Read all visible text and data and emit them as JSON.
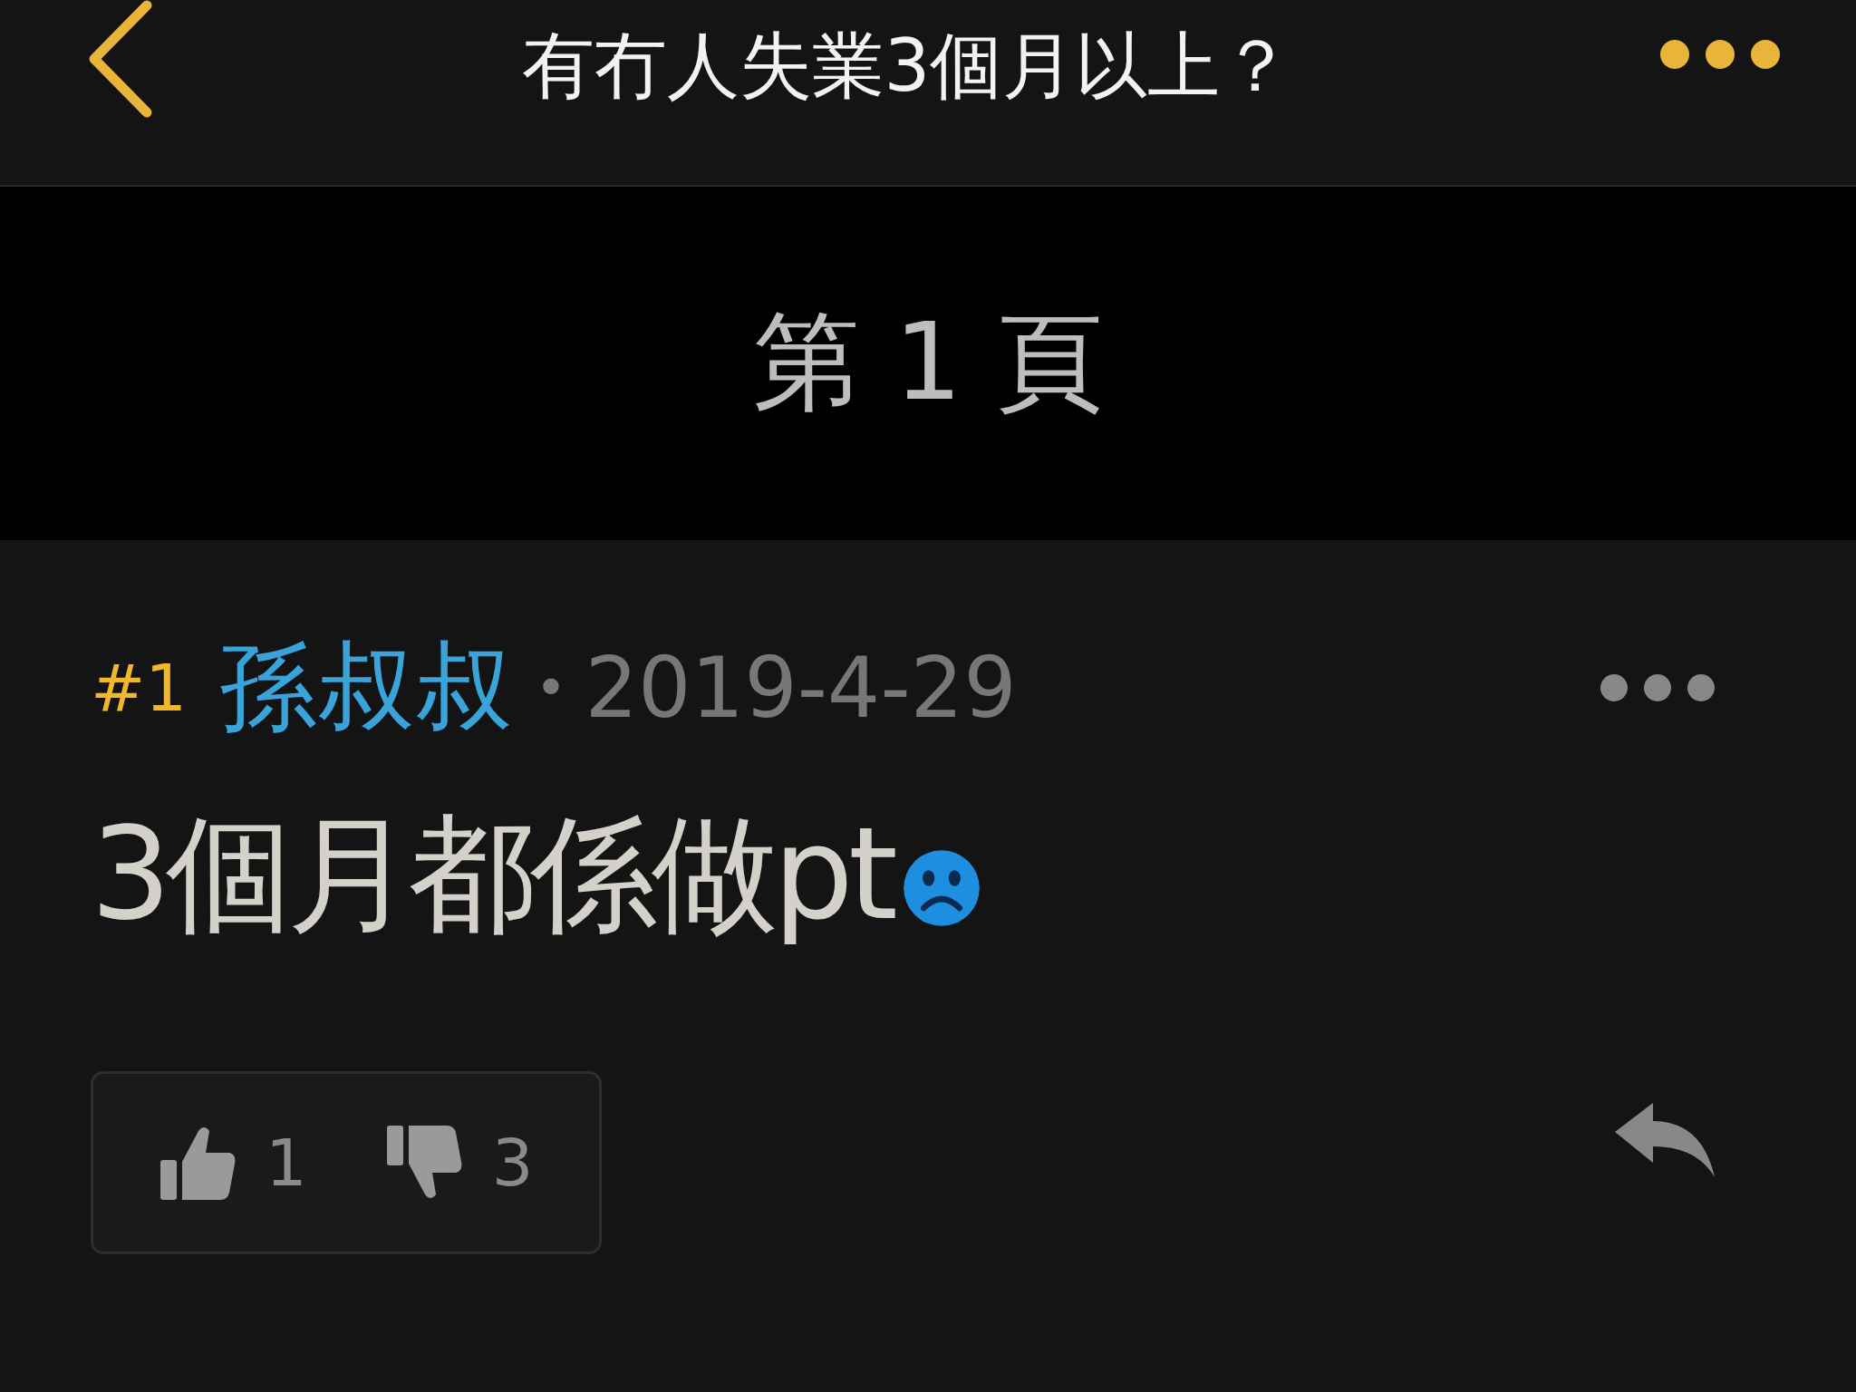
{
  "header": {
    "title": "有冇人失業3個月以上？"
  },
  "page_banner": {
    "label": "第 1 頁"
  },
  "post": {
    "number": "#1",
    "author": "孫叔叔",
    "separator": "•",
    "date": "2019-4-29",
    "content": "3個月都係做pt",
    "votes": [
      {
        "kind": "up",
        "count": "1"
      },
      {
        "kind": "down",
        "count": "3"
      }
    ]
  }
}
